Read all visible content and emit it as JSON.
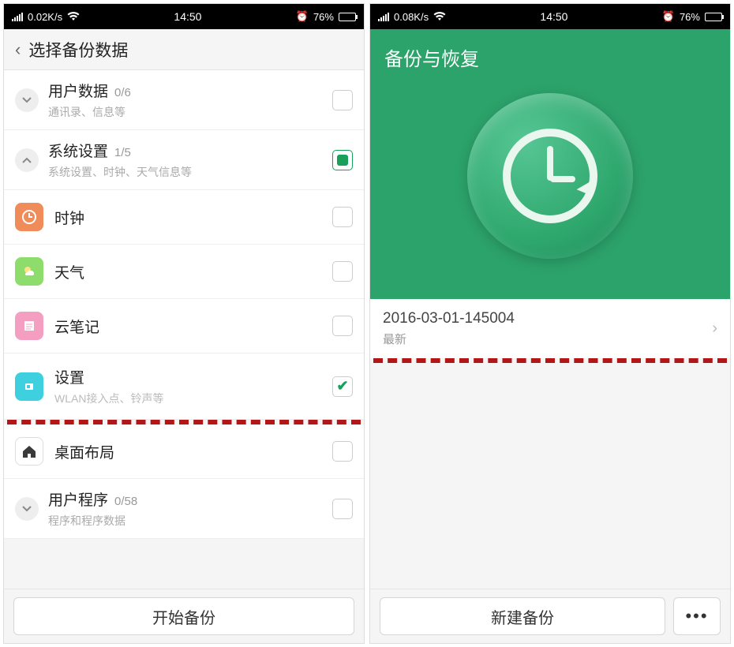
{
  "status": {
    "speed_left": "0.02K/s",
    "speed_right": "0.08K/s",
    "time": "14:50",
    "battery": "76%"
  },
  "left": {
    "header": "选择备份数据",
    "groups": [
      {
        "title": "用户数据",
        "count": "0/6",
        "sub": "通讯录、信息等",
        "expanded": false,
        "checked": false
      },
      {
        "title": "系统设置",
        "count": "1/5",
        "sub": "系统设置、时钟、天气信息等",
        "expanded": true,
        "checked": true
      }
    ],
    "items": [
      {
        "title": "时钟",
        "sub": "",
        "color": "#f08b5a",
        "checked": false
      },
      {
        "title": "天气",
        "sub": "",
        "color": "#8edc6b",
        "checked": false
      },
      {
        "title": "云笔记",
        "sub": "",
        "color": "#f49fc1",
        "checked": false
      },
      {
        "title": "设置",
        "sub": "WLAN接入点、铃声等",
        "color": "#3fd0e0",
        "checked": true
      }
    ],
    "extra": {
      "title": "桌面布局"
    },
    "group3": {
      "title": "用户程序",
      "count": "0/58",
      "sub": "程序和程序数据"
    },
    "start_btn": "开始备份"
  },
  "right": {
    "title": "备份与恢复",
    "backup": {
      "name": "2016-03-01-145004",
      "tag": "最新"
    },
    "new_btn": "新建备份"
  }
}
